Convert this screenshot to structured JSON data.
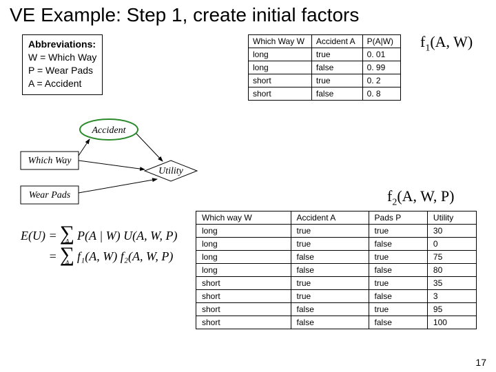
{
  "title": "VE Example: Step 1, create initial factors",
  "abbrev": {
    "header": "Abbreviations:",
    "lines": [
      "W = Which Way",
      "P  = Wear Pads",
      "A  = Accident"
    ]
  },
  "diagram": {
    "accident": "Accident",
    "whichway": "Which Way",
    "wearpads": "Wear Pads",
    "utility": "Utility"
  },
  "f1": {
    "label_prefix": "f",
    "label_sub": "1",
    "label_args": "(A, W)",
    "headers": [
      "Which Way W",
      "Accident A",
      "P(A|W)"
    ],
    "rows": [
      [
        "long",
        "true",
        "0. 01"
      ],
      [
        "long",
        "false",
        "0. 99"
      ],
      [
        "short",
        "true",
        "0. 2"
      ],
      [
        "short",
        "false",
        "0. 8"
      ]
    ]
  },
  "f2": {
    "label_prefix": "f",
    "label_sub": "2",
    "label_args": "(A, W, P)",
    "headers": [
      "Which way W",
      "Accident A",
      "Pads P",
      "Utility"
    ],
    "rows": [
      [
        "long",
        "true",
        "true",
        "30"
      ],
      [
        "long",
        "true",
        "false",
        "0"
      ],
      [
        "long",
        "false",
        "true",
        "75"
      ],
      [
        "long",
        "false",
        "false",
        "80"
      ],
      [
        "short",
        "true",
        "true",
        "35"
      ],
      [
        "short",
        "true",
        "false",
        "3"
      ],
      [
        "short",
        "false",
        "true",
        "95"
      ],
      [
        "short",
        "false",
        "false",
        "100"
      ]
    ]
  },
  "formula": {
    "lhs": "E(U) =",
    "line1_rhs": "P(A | W) U(A, W, P)",
    "line2_lhs": "=",
    "line2_rhs": "f₁(A, W) f₂(A, W, P)",
    "sum_sub": "A"
  },
  "pagenum": "17"
}
